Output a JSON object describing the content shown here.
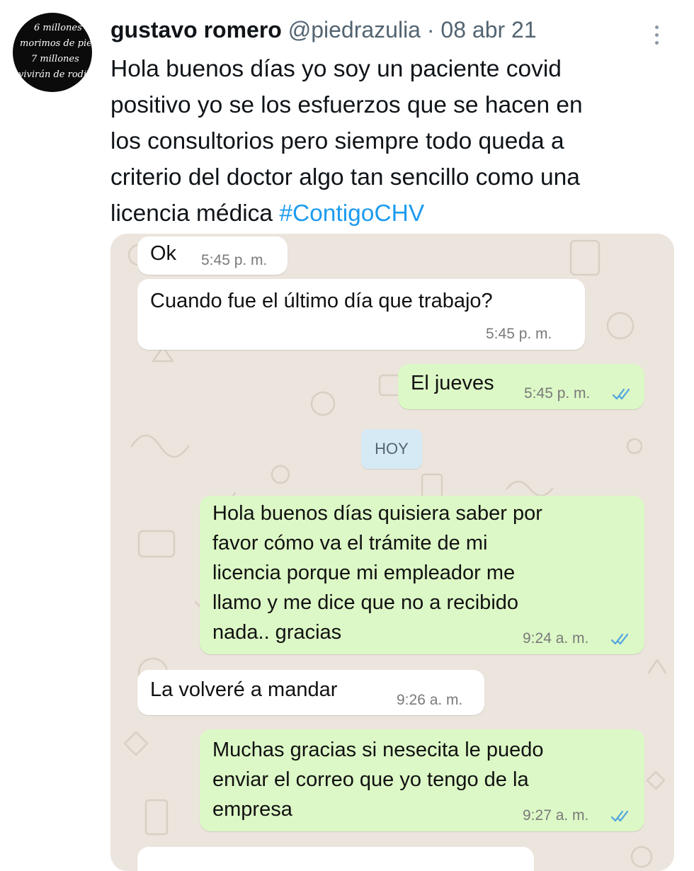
{
  "tweet": {
    "author_name": "gustavo romero",
    "handle": "@piedrazulia",
    "separator": "·",
    "date": "08 abr 21",
    "text_lines": [
      "Hola buenos días yo soy un paciente covid",
      "positivo yo se los esfuerzos que se hacen en",
      "los consultorios pero siempre todo queda a",
      "criterio del doctor algo tan sencillo como una",
      "licencia médica"
    ],
    "hashtag": "#ContigoCHV",
    "avatar_text": [
      "6 millones",
      "morimos de pie, pero",
      "7 millones",
      "vivirán de rodilla"
    ],
    "more_icon": "more-options-icon"
  },
  "chat": {
    "messages": [
      {
        "text_lines": [
          "Ok"
        ],
        "time": "5:45 p. m."
      },
      {
        "text_lines": [
          "Cuando fue el último día que trabajo?"
        ],
        "time": "5:45 p. m."
      },
      {
        "text_lines": [
          "El jueves"
        ],
        "time": "5:45 p. m."
      },
      {
        "text_lines": [
          "Hola buenos días quisiera saber por",
          "favor cómo va el trámite de mi",
          "licencia porque mi empleador me",
          "llamo y me dice que no a  recibido",
          "nada.. gracias"
        ],
        "time": "9:24 a. m."
      },
      {
        "text_lines": [
          "La volveré a mandar"
        ],
        "time": "9:26 a. m."
      },
      {
        "text_lines": [
          "Muchas gracias si nesecita le puedo",
          "enviar el correo que yo tengo de la",
          "empresa"
        ],
        "time": "9:27 a. m."
      }
    ],
    "day_separator": "HOY"
  },
  "colors": {
    "hashtag": "#1d9bf0",
    "outgoing_bubble": "#dcf8c6",
    "incoming_bubble": "#ffffff",
    "read_ticks": "#4fa3e0",
    "chat_wallpaper": "#ece5dd",
    "day_chip": "#d5eaf5"
  }
}
